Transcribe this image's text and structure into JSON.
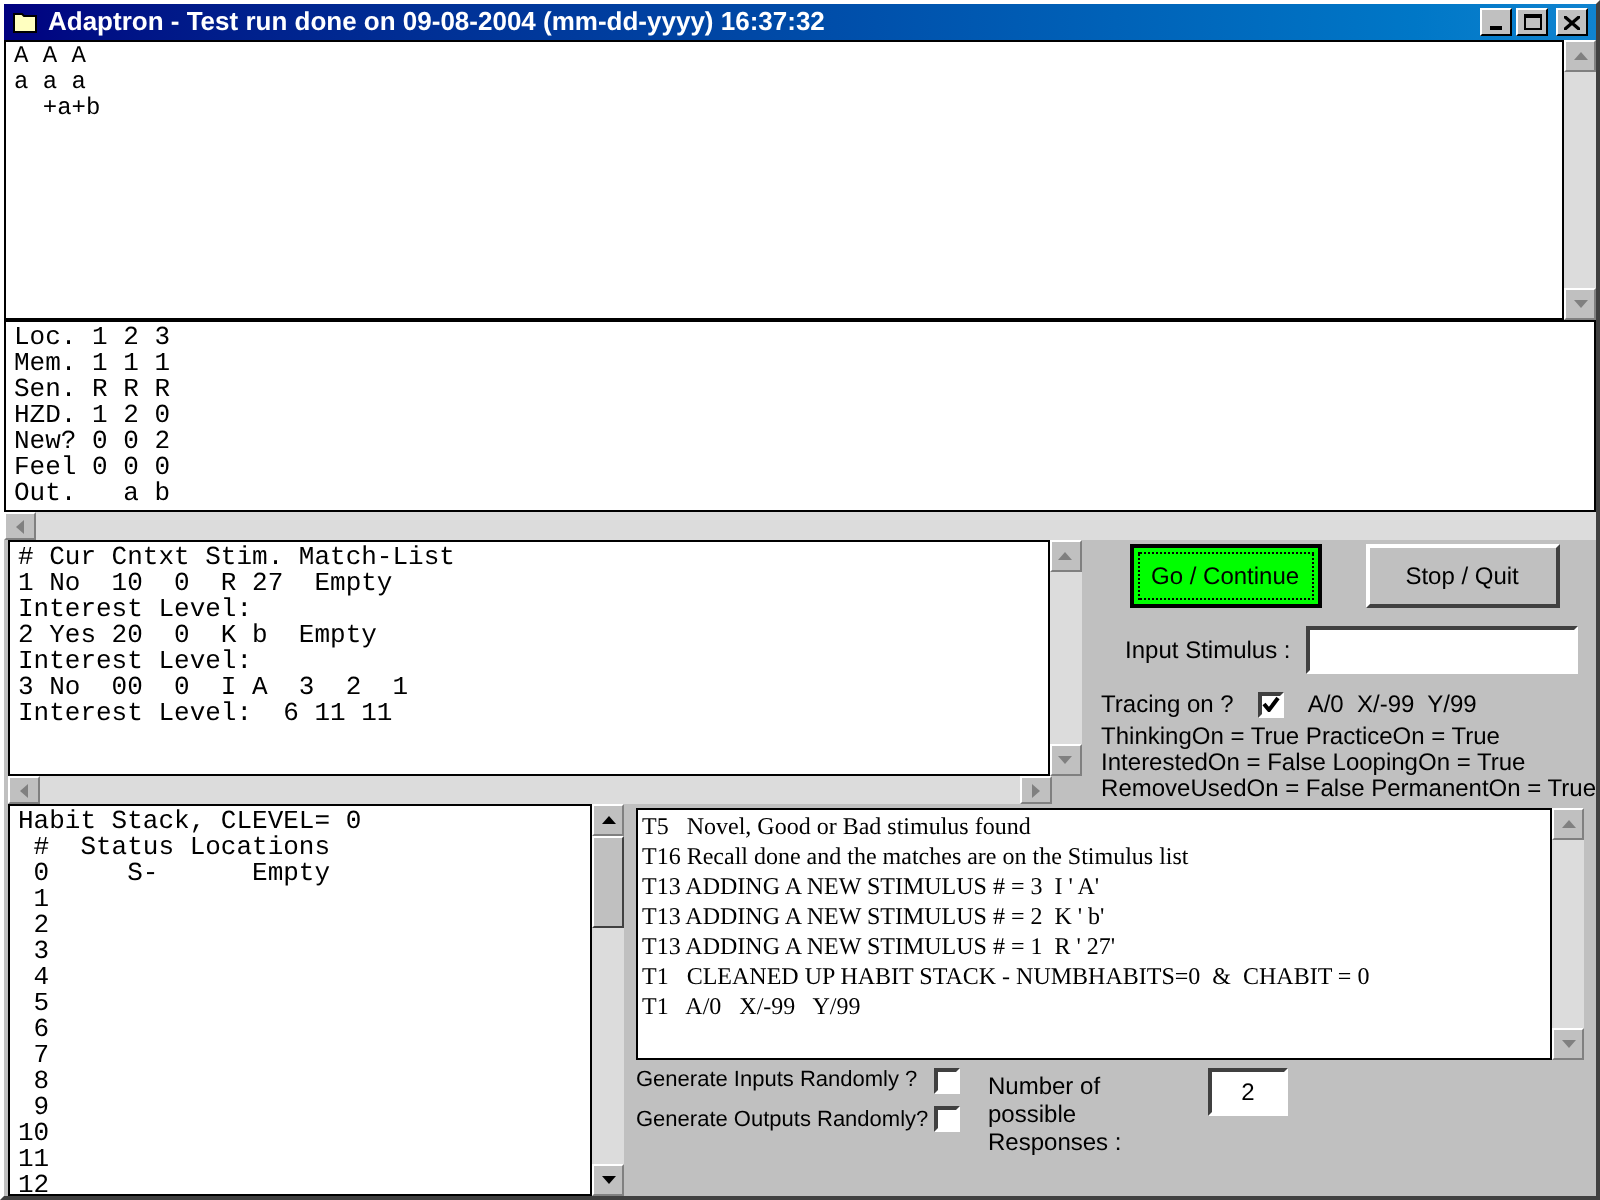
{
  "window": {
    "title": "Adaptron - Test run done on 09-08-2004 (mm-dd-yyyy) 16:37:32"
  },
  "output_text": [
    "A A A",
    "a a a",
    "  +a+b"
  ],
  "memory_table": [
    "Loc. 1 2 3",
    "Mem. 1 1 1",
    "Sen. R R R",
    "HZD. 1 2 0",
    "New? 0 0 2",
    "Feel 0 0 0",
    "Out.   a b"
  ],
  "stimulus_list": [
    "# Cur Cntxt Stim. Match-List",
    "1 No  10  0  R 27  Empty",
    "Interest Level:",
    "2 Yes 20  0  K b  Empty",
    "Interest Level:",
    "3 No  00  0  I A  3  2  1",
    "Interest Level:  6 11 11"
  ],
  "buttons": [
    {
      "label": "Go / Continue",
      "selected": true
    },
    {
      "label": "Stop / Quit",
      "selected": false
    }
  ],
  "input_stimulus": {
    "label": "Input Stimulus :"
  },
  "tracing": {
    "label": "Tracing on ?",
    "checked": true,
    "values": "A/0  X/-99  Y/99"
  },
  "flags": [
    "ThinkingOn = True PracticeOn = True",
    "InterestedOn = False LoopingOn = True",
    "RemoveUsedOn = False PermanentOn = True"
  ],
  "habit_stack": [
    "Habit Stack, CLEVEL= 0",
    " #  Status Locations",
    " 0     S-      Empty",
    " 1",
    " 2",
    " 3",
    " 4",
    " 5",
    " 6",
    " 7",
    " 8",
    " 9",
    "10",
    "11",
    "12"
  ],
  "trace_log": [
    "T5   Novel, Good or Bad stimulus found",
    "T16 Recall done and the matches are on the Stimulus list",
    "T13 ADDING A NEW STIMULUS # = 3  I ' A'",
    "T13 ADDING A NEW STIMULUS # = 2  K ' b'",
    "T13 ADDING A NEW STIMULUS # = 1  R ' 27'",
    "T1   CLEANED UP HABIT STACK - NUMBHABITS=0  &  CHABIT = 0",
    "T1   A/0   X/-99   Y/99"
  ],
  "random_options": [
    {
      "label": "Generate Inputs Randomly ?",
      "checked": false
    },
    {
      "label": "Generate Outputs Randomly?",
      "checked": false
    }
  ],
  "responses": {
    "label": "Number of possible Responses :",
    "value": "2"
  }
}
